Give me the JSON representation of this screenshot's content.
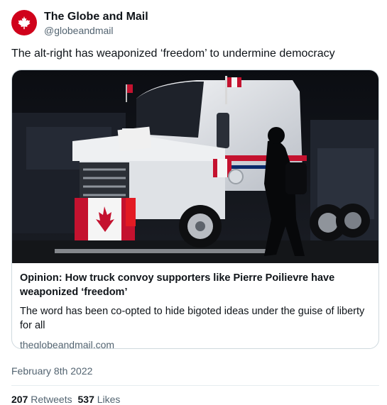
{
  "author": {
    "name": "The Globe and Mail",
    "handle": "@globeandmail",
    "avatar_color": "#d0021b",
    "avatar_icon": "maple-leaf-icon"
  },
  "tweet": {
    "text": "The alt-right has weaponized ‘freedom’ to undermine democracy"
  },
  "card": {
    "image_description_icon": "truck-photo",
    "title": "Opinion: How truck convoy supporters like Pierre Poilievre have weaponized ‘freedom’",
    "description": "The word has been co-opted to hide bigoted ideas under the guise of liberty for all",
    "domain": "theglobeandmail.com"
  },
  "meta": {
    "date": "February 8th 2022"
  },
  "stats": {
    "retweets_count": "207",
    "retweets_label": "Retweets",
    "likes_count": "537",
    "likes_label": "Likes"
  }
}
